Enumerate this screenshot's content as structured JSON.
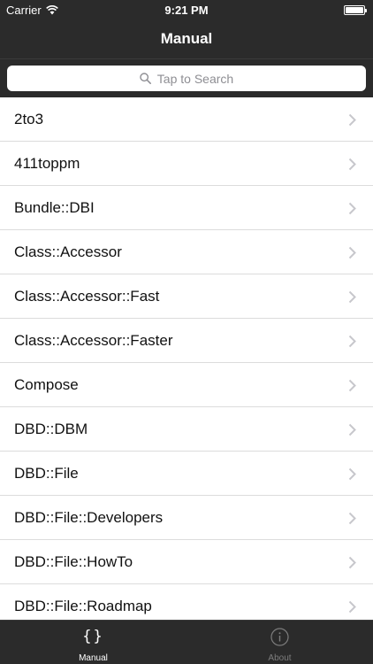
{
  "status_bar": {
    "carrier": "Carrier",
    "time": "9:21 PM",
    "wifi_icon": "wifi-icon",
    "battery_icon": "battery-icon"
  },
  "nav": {
    "title": "Manual"
  },
  "search": {
    "placeholder": "Tap to Search",
    "icon": "search-icon"
  },
  "list": {
    "items": [
      {
        "label": "2to3"
      },
      {
        "label": "411toppm"
      },
      {
        "label": "Bundle::DBI"
      },
      {
        "label": "Class::Accessor"
      },
      {
        "label": "Class::Accessor::Fast"
      },
      {
        "label": "Class::Accessor::Faster"
      },
      {
        "label": "Compose"
      },
      {
        "label": "DBD::DBM"
      },
      {
        "label": "DBD::File"
      },
      {
        "label": "DBD::File::Developers"
      },
      {
        "label": "DBD::File::HowTo"
      },
      {
        "label": "DBD::File::Roadmap"
      }
    ],
    "chevron_icon": "chevron-right-icon"
  },
  "tab_bar": {
    "tabs": [
      {
        "label": "Manual",
        "icon": "braces-icon",
        "active": true
      },
      {
        "label": "About",
        "icon": "info-icon",
        "active": false
      }
    ]
  },
  "colors": {
    "bar_background": "#2b2b2b",
    "active_tab": "#ffffff",
    "inactive_tab": "#7d7d7d",
    "separator": "#dcdcdc"
  }
}
